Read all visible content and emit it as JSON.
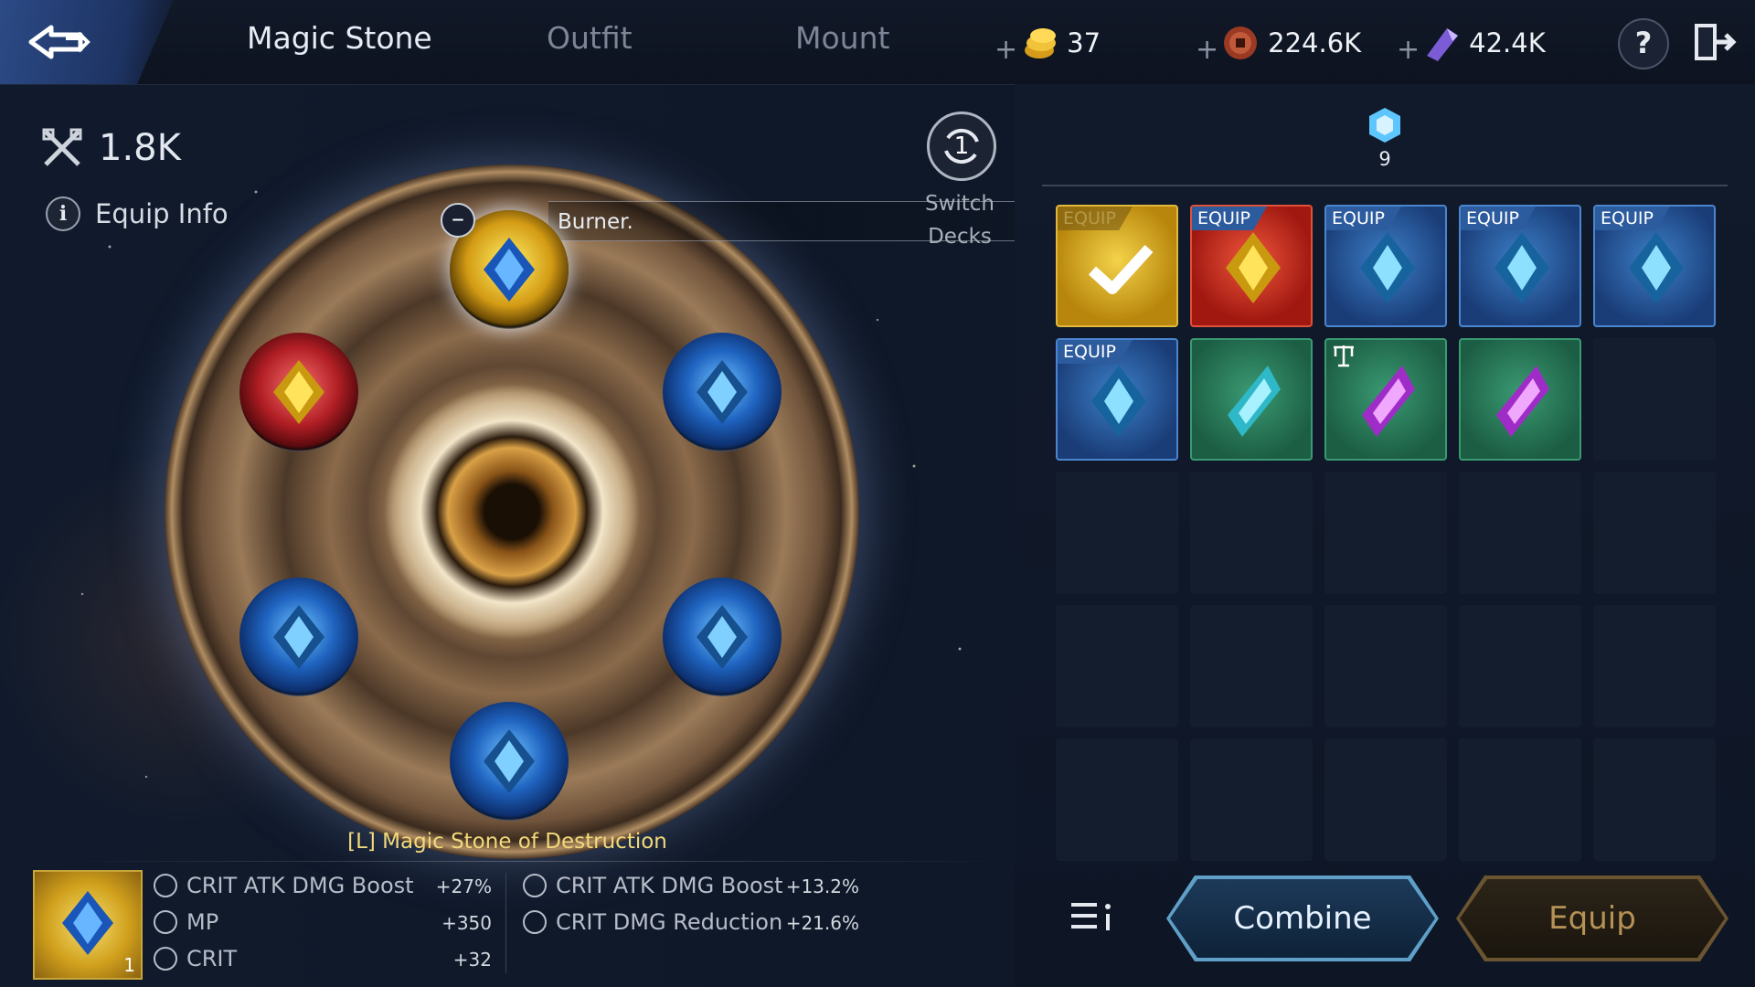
{
  "tabs": [
    {
      "label": "Magic Stone",
      "active": true
    },
    {
      "label": "Outfit",
      "active": false
    },
    {
      "label": "Mount",
      "active": false
    }
  ],
  "currencies": [
    {
      "icon": "gold-coin-icon",
      "value": "37"
    },
    {
      "icon": "bronze-coin-icon",
      "value": "224.6K"
    },
    {
      "icon": "purple-crystal-icon",
      "value": "42.4K"
    }
  ],
  "help_label": "?",
  "combat_power": "1.8K",
  "equip_info_label": "Equip Info",
  "burner_label": "Burner.",
  "switch": {
    "count": "1",
    "label_line1": "Switch",
    "label_line2": "Decks"
  },
  "deck": {
    "count": "9"
  },
  "selected_stone": {
    "name": "[L] Magic Stone of Destruction",
    "quantity": "1",
    "stats_left": [
      {
        "label": "CRIT ATK DMG Boost",
        "value": "+27%"
      },
      {
        "label": "MP",
        "value": "+350"
      },
      {
        "label": "CRIT",
        "value": "+32"
      }
    ],
    "stats_right": [
      {
        "label": "CRIT ATK DMG Boost",
        "value": "+13.2%"
      },
      {
        "label": "CRIT DMG Reduction",
        "value": "+21.6%"
      }
    ]
  },
  "inventory_equip_tag": "EQUIP",
  "buttons": {
    "combine": "Combine",
    "equip": "Equip"
  },
  "colors": {
    "accent_blue": "#2c5b9e",
    "gold": "#f2d97a",
    "active_tab": "#e7ecf5"
  }
}
